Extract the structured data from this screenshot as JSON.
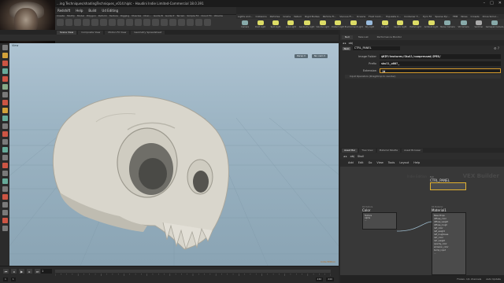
{
  "window": {
    "title": "...ing Techniques/shadingTechniques_v014.hiplc - Houdini Indie Limited-Commercial 18.0.391",
    "controls": [
      "–",
      "□",
      "✕"
    ]
  },
  "menu": {
    "items": [
      "Redshift",
      "Help",
      "Build",
      "Ud Editing"
    ]
  },
  "left_shelf": {
    "tabs": [
      "Create",
      "Modify",
      "Model",
      "Polygon",
      "Deform",
      "Texture",
      "Rigging",
      "Muscles",
      "Char...",
      "Guide B",
      "Guide P",
      "Terrain",
      "Simple FX",
      "Cloud FX",
      "Volume"
    ]
  },
  "right_shelf": {
    "tabs": [
      "Lights and...",
      "Collisions",
      "Particles",
      "Grains",
      "Vellum",
      "Rigid Bodies",
      "Particle Fl...",
      "Viscous Fl...",
      "Oceans",
      "Fluid Cont...",
      "Populate C...",
      "Container T...",
      "Pyro FX",
      "Sparse Pyr...",
      "FEM",
      "Wires",
      "Crowds",
      "Drive Simul..."
    ],
    "tools": [
      {
        "label": "Camera",
        "color": "#8aa"
      },
      {
        "label": "Point Light",
        "color": "#dd6"
      },
      {
        "label": "Spot Light",
        "color": "#dd6"
      },
      {
        "label": "Area Light",
        "color": "#dd6"
      },
      {
        "label": "Geometry Light",
        "color": "#dd6"
      },
      {
        "label": "Volume Light",
        "color": "#dd6"
      },
      {
        "label": "Distant Light",
        "color": "#dd6"
      },
      {
        "label": "Environment Light",
        "color": "#dd6"
      },
      {
        "label": "Sky Light",
        "color": "#9bd"
      },
      {
        "label": "GI Light",
        "color": "#dd6"
      },
      {
        "label": "Caustic Light",
        "color": "#dd6"
      },
      {
        "label": "Portal Light",
        "color": "#dd6"
      },
      {
        "label": "Ambient Light",
        "color": "#dd6"
      },
      {
        "label": "Stereo Camera",
        "color": "#8aa"
      },
      {
        "label": "VR Camera",
        "color": "#8aa"
      },
      {
        "label": "Switcher",
        "color": "#aaa"
      },
      {
        "label": "Gamepad Camera",
        "color": "#8aa"
      }
    ]
  },
  "left_tabs": [
    "Scene View",
    "Composite View",
    "Motion FX View",
    "Geometry Spreadsheet"
  ],
  "viewport": {
    "label": "View",
    "persp_label": "Persp ▾",
    "cam_label": "No cam ▾",
    "status": "Indie Edition"
  },
  "timeline": {
    "frame": "1",
    "start": "1",
    "end": "240",
    "fields": [
      "1",
      "1",
      "240",
      "240"
    ]
  },
  "param_panel": {
    "topbar": [
      "Null",
      "Take List",
      "Performance Monitor"
    ],
    "path": "obj",
    "node_type": "Null",
    "node_name": "CTRL_PANEL",
    "params": [
      {
        "label": "Image Folder",
        "value": "$HIP/textures/Skull/compressed/JPEG/"
      },
      {
        "label": "Prefix",
        "value": "skull_u00?_"
      },
      {
        "label": "Extension",
        "value": "jd"
      }
    ],
    "folder": "Input Operators (Drag/Drop to reorder)"
  },
  "network": {
    "tabs": [
      "Asset Bar",
      "Tree View",
      "Material Palette",
      "Asset Browser"
    ],
    "path": [
      "obj",
      "Skull"
    ],
    "menu": [
      "Add",
      "Edit",
      "Go",
      "View",
      "Tools",
      "Layout",
      "Help"
    ],
    "watermark": "VEX Builder",
    "watermark_sub": "Indie Edition",
    "nodes": {
      "ctrl_panel": {
        "title": "CTRL_PANEL",
        "type": "Null"
      },
      "color": {
        "title": "Color",
        "type": "RS Texture",
        "ports": [
          "Texture",
          "Alpha",
          "..."
        ]
      },
      "material": {
        "title": "Material1",
        "type": "RS Material",
        "ports": [
          "Base Props",
          "diffuse_color",
          "diffuse_weight",
          "diffuse_rough",
          "refl_color",
          "refl_weight",
          "refl_roughness",
          "refr_color",
          "refr_weight",
          "opacity_color",
          "emission_color",
          "bump_input",
          "..."
        ]
      }
    }
  },
  "status": {
    "text": "Frozen, 1/1 channels",
    "mode": "Auto Update"
  }
}
